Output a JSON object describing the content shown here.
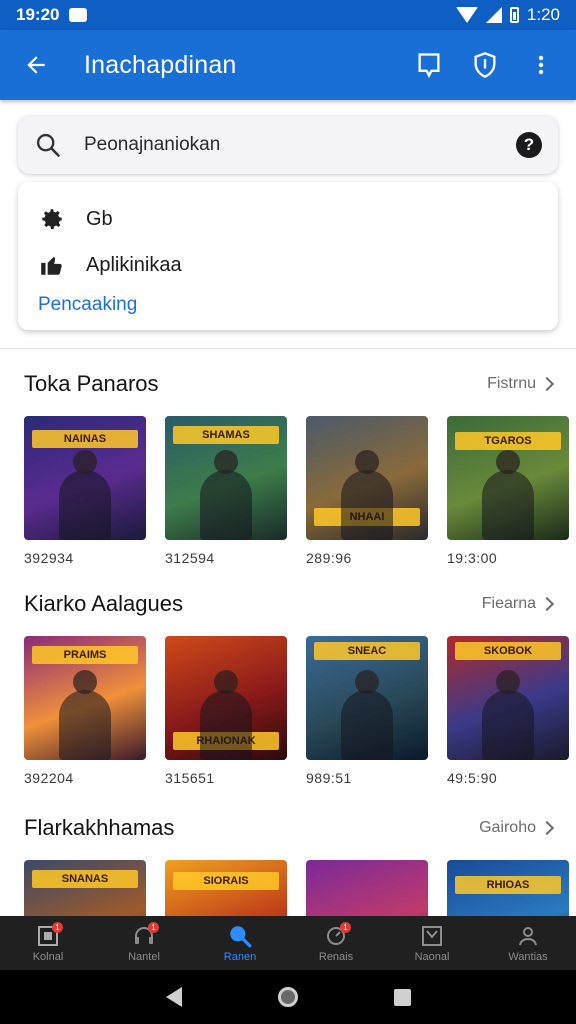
{
  "status_bar": {
    "time": "19:20",
    "battery": "1:20"
  },
  "app_bar": {
    "title": "Inachapdinan"
  },
  "search": {
    "placeholder": "Peonajnaniokan"
  },
  "dropdown": {
    "items": [
      {
        "label": "Gb",
        "icon": "gear-icon"
      },
      {
        "label": "Aplikinikaa",
        "icon": "thumbs-up-icon"
      }
    ],
    "link": "Pencaaking"
  },
  "sections": [
    {
      "title": "Toka Panaros",
      "more": "Fistrnu",
      "cards": [
        {
          "caption": "392934",
          "banner": "NAINAS"
        },
        {
          "caption": "312594",
          "banner": "SHAMAS"
        },
        {
          "caption": "289:96",
          "banner": "NHAAI"
        },
        {
          "caption": "19:3:00",
          "banner": "TGAROS"
        }
      ]
    },
    {
      "title": "Kiarko Aalagues",
      "more": "Fiearna",
      "cards": [
        {
          "caption": "392204",
          "banner": "PRAIMS"
        },
        {
          "caption": "315651",
          "banner": "RHAIONAK"
        },
        {
          "caption": "989:51",
          "banner": "SNEAC"
        },
        {
          "caption": "49:5:90",
          "banner": "SKOBOK"
        }
      ]
    },
    {
      "title": "Flarkakhhamas",
      "more": "Gairoho",
      "cards": [
        {
          "caption": "",
          "banner": "SNANAS"
        },
        {
          "caption": "",
          "banner": "SIORAIS"
        },
        {
          "caption": "",
          "banner": ""
        },
        {
          "caption": "",
          "banner": "RHIOAS"
        }
      ]
    }
  ],
  "bottom_nav": [
    {
      "label": "Kolnal",
      "icon": "home-icon",
      "badge": "1"
    },
    {
      "label": "Nantel",
      "icon": "headset-icon",
      "badge": "1"
    },
    {
      "label": "Ranen",
      "icon": "search-icon",
      "active": true
    },
    {
      "label": "Renais",
      "icon": "refresh-icon",
      "badge": "1"
    },
    {
      "label": "Naonal",
      "icon": "library-icon"
    },
    {
      "label": "Wantias",
      "icon": "person-icon"
    }
  ],
  "colors": {
    "primary": "#1a6fd6",
    "status_bar": "#0f5ec4",
    "nav_active": "#2f8cff",
    "nav_bg": "#202020"
  }
}
